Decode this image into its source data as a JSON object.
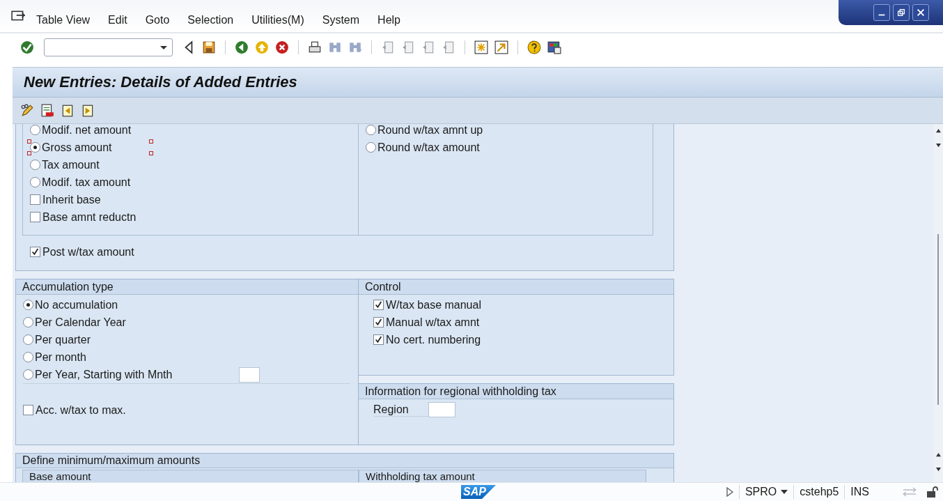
{
  "menu_bar": {
    "items": [
      "Table View",
      "Edit",
      "Goto",
      "Selection",
      "Utilities(M)",
      "System",
      "Help"
    ]
  },
  "screen_title": "New Entries: Details of Added Entries",
  "tax_base_group": {
    "left_options": [
      {
        "kind": "radio",
        "label": "Modif. net amount",
        "selected": false,
        "focused": false
      },
      {
        "kind": "radio",
        "label": "Gross amount",
        "selected": true,
        "focused": true
      },
      {
        "kind": "radio",
        "label": "Tax amount",
        "selected": false,
        "focused": false
      },
      {
        "kind": "radio",
        "label": "Modif. tax amount",
        "selected": false,
        "focused": false
      },
      {
        "kind": "checkbox",
        "label": "Inherit base",
        "checked": false,
        "focused": false
      },
      {
        "kind": "checkbox",
        "label": "Base amnt reductn",
        "checked": false,
        "focused": false
      }
    ],
    "right_options": [
      {
        "label": "Round w/tax amnt up",
        "selected": false,
        "focused": false
      },
      {
        "label": "Round w/tax amount",
        "selected": false,
        "focused": false
      }
    ],
    "post_option": {
      "label": "Post w/tax amount",
      "checked": true,
      "focused": false
    }
  },
  "accumulation_type": {
    "title": "Accumulation type",
    "options": [
      {
        "label": "No accumulation",
        "selected": true
      },
      {
        "label": "Per Calendar Year",
        "selected": false
      },
      {
        "label": "Per quarter",
        "selected": false
      },
      {
        "label": "Per month",
        "selected": false
      },
      {
        "label": "Per Year, Starting with Mnth",
        "selected": false,
        "has_field": true
      }
    ],
    "max_option": {
      "label": "Acc. w/tax to max.",
      "checked": false
    }
  },
  "control": {
    "title": "Control",
    "options": [
      {
        "label": "W/tax base manual",
        "checked": true
      },
      {
        "label": "Manual w/tax amnt",
        "checked": true
      },
      {
        "label": "No cert. numbering",
        "checked": true
      }
    ]
  },
  "regional": {
    "title": "Information for regional withholding tax",
    "field_label": "Region"
  },
  "min_max": {
    "title": "Define minimum/maximum amounts",
    "subgroups": [
      "Base amount",
      "Withholding tax amount"
    ]
  },
  "status_bar": {
    "logo": "SAP",
    "transaction": "SPRO",
    "server": "cstehp5",
    "mode": "INS"
  }
}
